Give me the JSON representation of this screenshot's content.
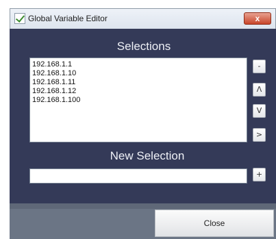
{
  "window": {
    "title": "Global Variable Editor",
    "close_glyph": "x"
  },
  "selections": {
    "heading": "Selections",
    "items": [
      "192.168.1.1",
      "192.168.1.10",
      "192.168.1.11",
      "192.168.1.12",
      "192.168.1.100"
    ]
  },
  "side_buttons": {
    "remove_label": "-",
    "up_label": "Λ",
    "down_label": "V",
    "move_label": ">"
  },
  "new_selection": {
    "heading": "New Selection",
    "value": "",
    "add_label": "+"
  },
  "footer": {
    "close_label": "Close"
  },
  "icons": {
    "app": "checkmark-edit-icon",
    "close": "close-icon"
  },
  "colors": {
    "panel_bg": "#343a58",
    "footer_bg": "#6b7585",
    "close_button_red": "#c8452a"
  }
}
